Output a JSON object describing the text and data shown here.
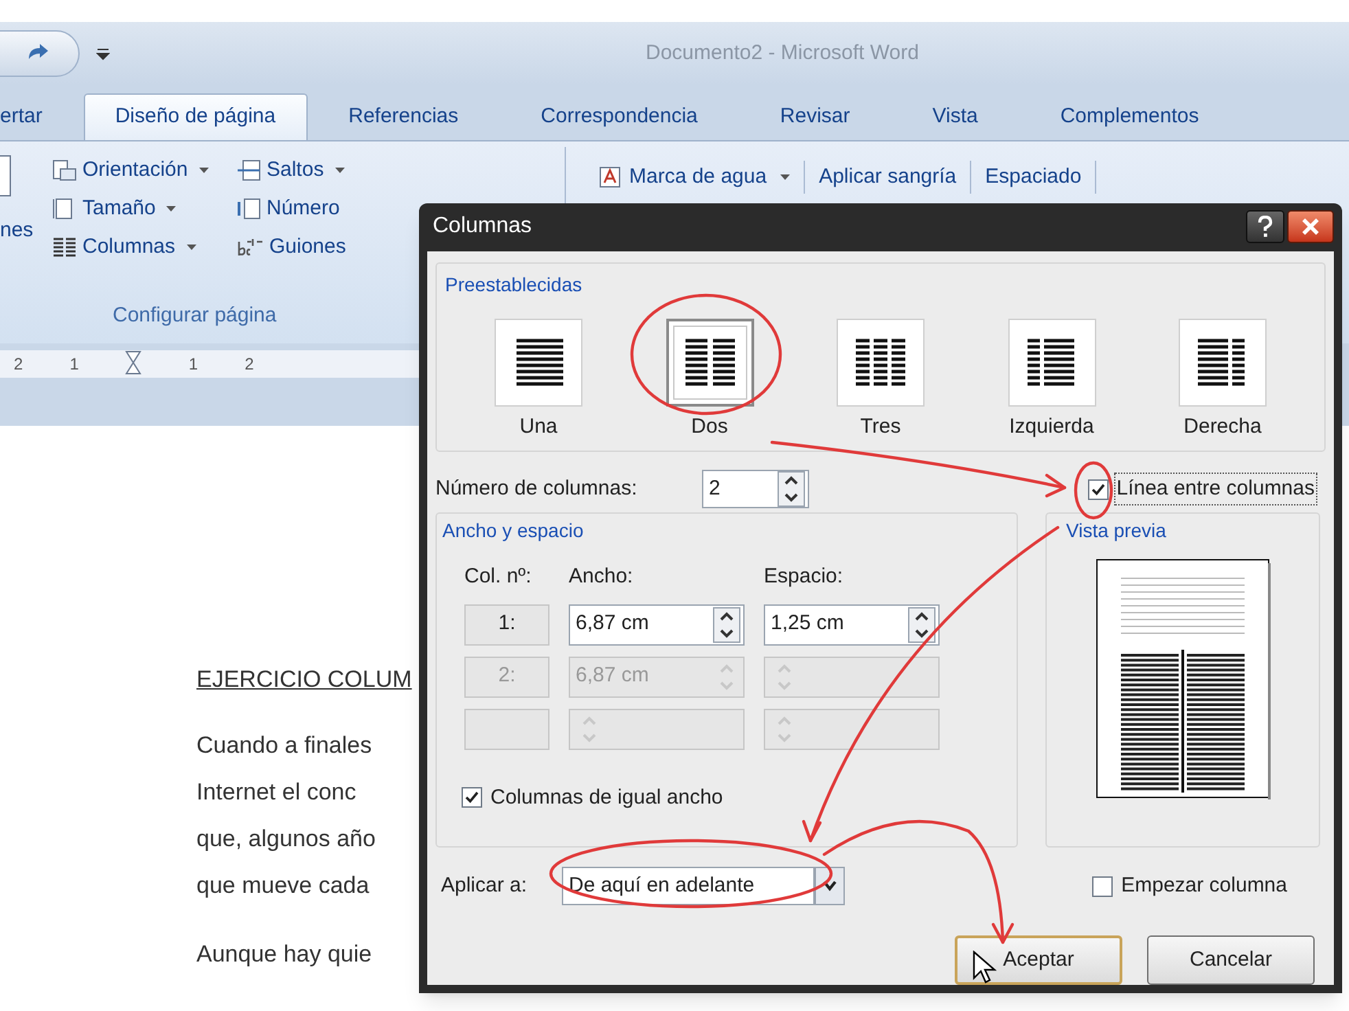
{
  "window": {
    "title": "Documento2 - Microsoft Word"
  },
  "tabs": [
    {
      "label": "ertar",
      "selected": false
    },
    {
      "label": "Diseño de página",
      "selected": true
    },
    {
      "label": "Referencias",
      "selected": false
    },
    {
      "label": "Correspondencia",
      "selected": false
    },
    {
      "label": "Revisar",
      "selected": false
    },
    {
      "label": "Vista",
      "selected": false
    },
    {
      "label": "Complementos",
      "selected": false
    }
  ],
  "ribbon": {
    "cut_label": "nes",
    "page_setup": {
      "column_1": [
        {
          "label": "Orientación",
          "kind": "orientation"
        },
        {
          "label": "Tamaño",
          "kind": "size"
        },
        {
          "label": "Columnas",
          "kind": "columns"
        }
      ],
      "column_2": [
        {
          "label": "Saltos",
          "kind": "breaks"
        },
        {
          "label": "Número",
          "kind": "numbers"
        },
        {
          "label": "Guiones",
          "kind": "hyphen"
        }
      ],
      "group_label": "Configurar página"
    },
    "background": [
      {
        "label": "Marca de agua",
        "kind": "watermark"
      },
      {
        "label": "Aplicar sangría",
        "kind": "plain"
      },
      {
        "label": "Espaciado",
        "kind": "plain"
      }
    ]
  },
  "ruler": {
    "labels": [
      "2",
      "1",
      "1",
      "2"
    ]
  },
  "document": {
    "heading": "EJERCICIO COLUM",
    "paragraphs": [
      [
        {
          "text": "Cuando a finales"
        },
        {
          "text": "Internet el conc"
        },
        {
          "text": "que, algunos año"
        },
        {
          "text": "que mueve cada"
        }
      ],
      [
        {
          "text": "Aunque hay quie"
        }
      ]
    ]
  },
  "dialog": {
    "title": "Columnas",
    "presets_label": "Preestablecidas",
    "presets": [
      {
        "label": "Una",
        "kind": "one",
        "selected": false
      },
      {
        "label": "Dos",
        "kind": "two",
        "selected": true
      },
      {
        "label": "Tres",
        "kind": "three",
        "selected": false
      },
      {
        "label": "Izquierda",
        "kind": "left",
        "selected": false
      },
      {
        "label": "Derecha",
        "kind": "right",
        "selected": false
      }
    ],
    "num_columns": {
      "label": "Número de columnas:",
      "value": "2"
    },
    "line_between": {
      "label": "Línea entre columnas",
      "checked": true
    },
    "width_spacing": {
      "label": "Ancho y espacio",
      "headers": [
        "Col. nº:",
        "Ancho:",
        "Espacio:"
      ],
      "rows": [
        {
          "col": "1:",
          "width": "6,87 cm",
          "spacing": "1,25 cm",
          "disabled": false
        },
        {
          "col": "2:",
          "width": "6,87 cm",
          "disabled": true
        },
        {
          "disabled": true
        }
      ]
    },
    "equal_width": {
      "label": "Columnas de igual ancho",
      "checked": true
    },
    "preview": {
      "label": "Vista previa"
    },
    "apply_to": {
      "label": "Aplicar a:",
      "value": "De aquí en adelante"
    },
    "start_column": {
      "label": "Empezar columna",
      "checked": false
    },
    "buttons": [
      {
        "label": "Aceptar",
        "kind": "default"
      },
      {
        "label": "Cancelar",
        "kind": "normal"
      }
    ]
  }
}
